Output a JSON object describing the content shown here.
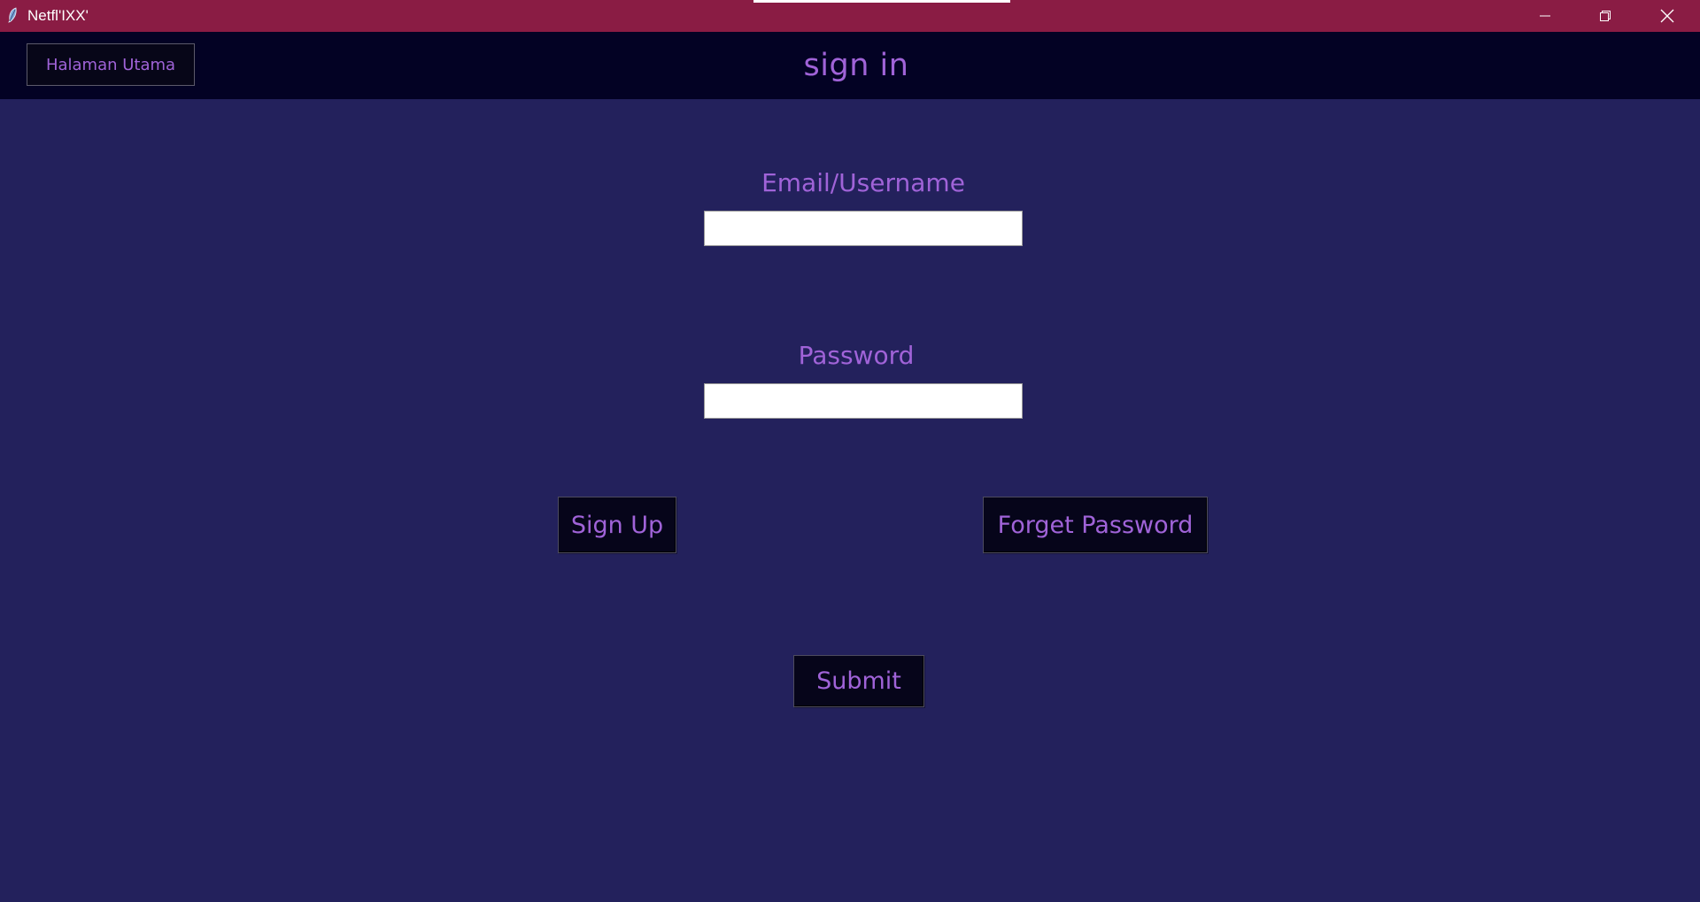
{
  "window": {
    "title": "Netfl'IXX'",
    "controls": [
      "minimize-icon",
      "restore-icon",
      "close-icon"
    ]
  },
  "header": {
    "home_label": "Halaman Utama",
    "title": "sign in"
  },
  "form": {
    "email_label": "Email/Username",
    "email_value": "",
    "password_label": "Password",
    "password_value": ""
  },
  "buttons": {
    "signup_label": "Sign Up",
    "forget_label": "Forget Password",
    "submit_label": "Submit"
  },
  "colors": {
    "titlebar": "#8a1c44",
    "header": "#030224",
    "background": "#23215c",
    "accent_text": "#a063d8",
    "button_bg": "#06051a"
  }
}
